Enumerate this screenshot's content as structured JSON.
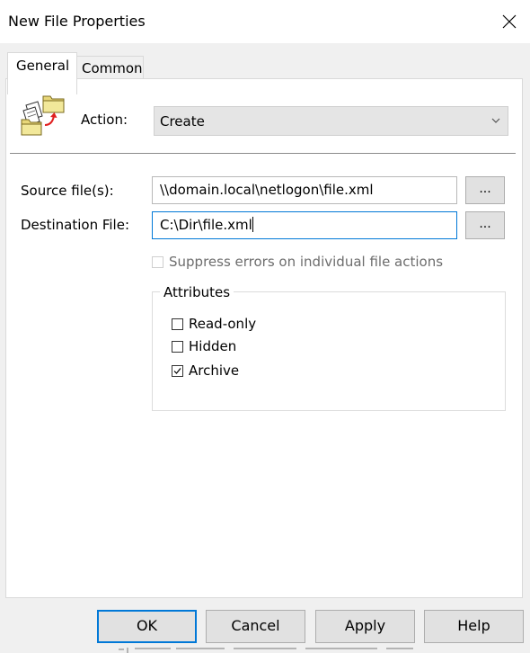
{
  "window": {
    "title": "New File Properties"
  },
  "tabs": [
    {
      "label": "General",
      "active": true
    },
    {
      "label": "Common",
      "active": false
    }
  ],
  "general": {
    "action_label": "Action:",
    "action_value": "Create",
    "source_label": "Source file(s):",
    "source_value": "\\\\domain.local\\netlogon\\file.xml",
    "destination_label": "Destination File:",
    "destination_value": "C:\\Dir\\file.xml",
    "browse_label": "...",
    "suppress_label": "Suppress errors on individual file actions",
    "suppress_checked": false,
    "attributes_title": "Attributes",
    "attributes": [
      {
        "label": "Read-only",
        "checked": false
      },
      {
        "label": "Hidden",
        "checked": false
      },
      {
        "label": "Archive",
        "checked": true
      }
    ]
  },
  "buttons": {
    "ok": "OK",
    "cancel": "Cancel",
    "apply": "Apply",
    "help": "Help"
  },
  "colors": {
    "focus_border": "#0078d7",
    "dialog_bg": "#f0f0f0",
    "panel_bg": "#ffffff"
  }
}
